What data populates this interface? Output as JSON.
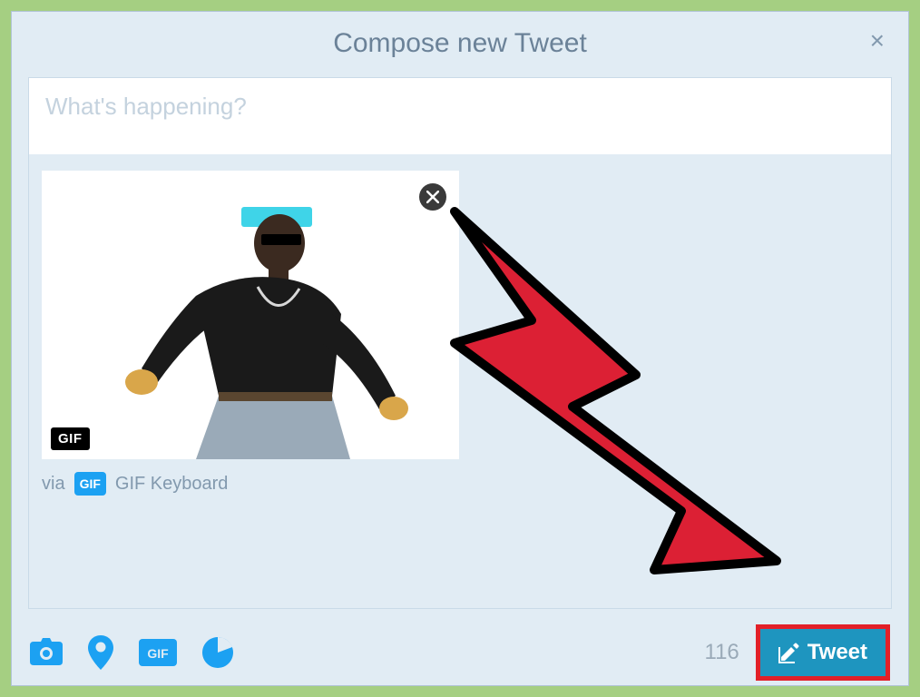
{
  "dialog": {
    "title": "Compose new Tweet",
    "close_label": "×"
  },
  "composer": {
    "placeholder": "What's happening?",
    "value": ""
  },
  "media": {
    "gif_badge": "GIF",
    "attribution_via": "via",
    "attribution_icon": "GIF",
    "attribution_source": "GIF Keyboard"
  },
  "footer": {
    "char_count": "116",
    "tweet_label": "Tweet",
    "icons": {
      "camera": "camera-icon",
      "location": "location-icon",
      "gif": "gif-icon",
      "poll": "poll-icon"
    }
  }
}
